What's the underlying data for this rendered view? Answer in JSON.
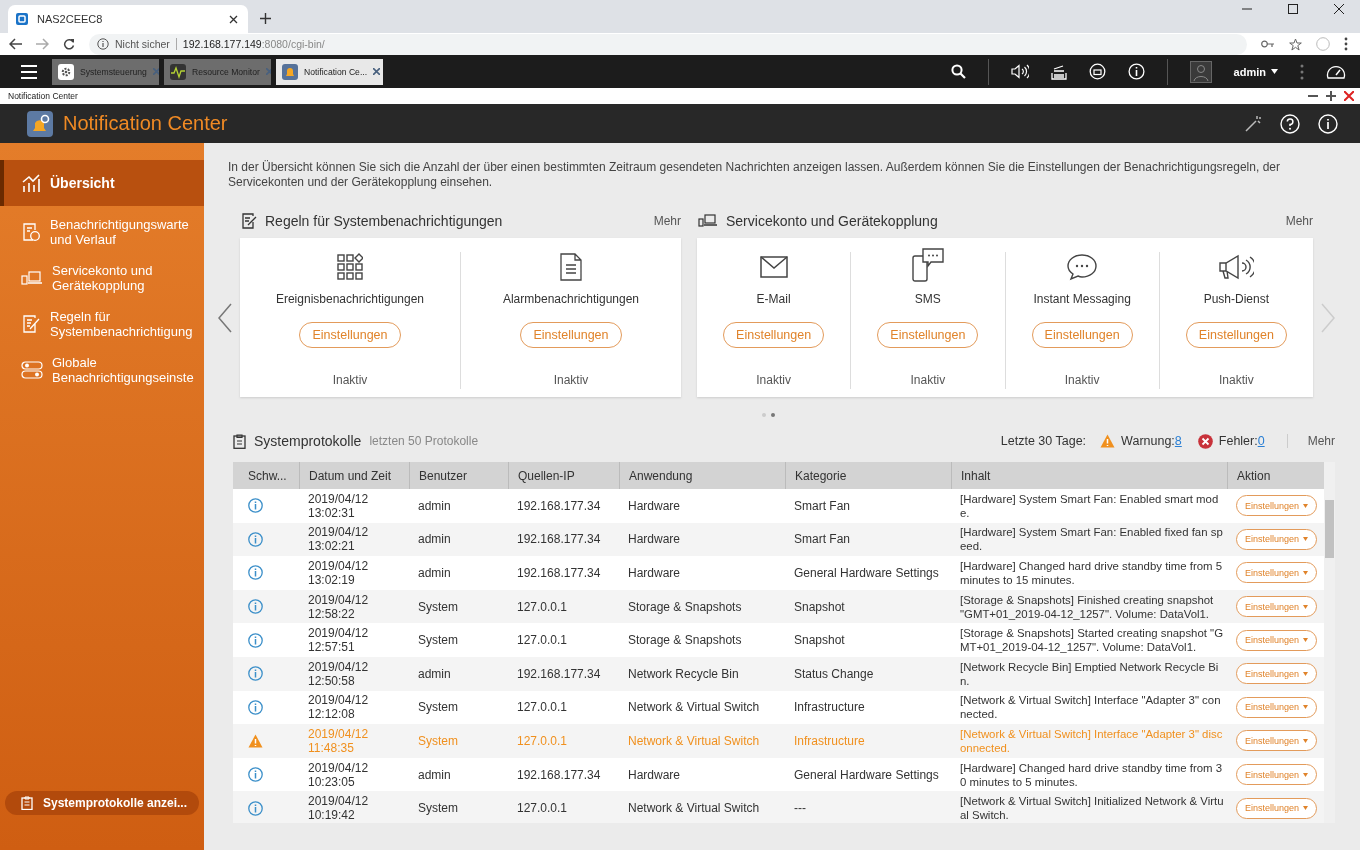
{
  "browser": {
    "tab_title": "NAS2CEEC8",
    "security": "Nicht sicher",
    "url_host": "192.168.177.149",
    "url_path": ":8080/cgi-bin/"
  },
  "taskbar": {
    "apps": [
      {
        "label": "Systemsteuerung",
        "selected": false
      },
      {
        "label": "Resource Monitor",
        "selected": false
      },
      {
        "label": "Notification Ce...",
        "selected": true
      }
    ],
    "user": "admin"
  },
  "window": {
    "title": "Notification Center",
    "app_title": "Notification Center"
  },
  "sidebar": {
    "items": [
      {
        "label": "Übersicht",
        "selected": true
      },
      {
        "label": "Benachrichtigungswarte und Verlauf",
        "selected": false
      },
      {
        "label": "Servicekonto und Gerätekopplung",
        "selected": false
      },
      {
        "label": "Regeln für Systembenachrichtigung",
        "selected": false
      },
      {
        "label": "Globale Benachrichtigungseinste",
        "selected": false
      }
    ],
    "bottom_button": "Systemprotokolle anzei..."
  },
  "intro": "In der Übersicht können Sie sich die Anzahl der über einen bestimmten Zeitraum gesendeten Nachrichten anzeigen lassen. Außerdem können Sie die Einstellungen der Benachrichtigungsregeln, der Servicekonten und der Gerätekopplung einsehen.",
  "panels": [
    {
      "title": "Regeln für Systembenachrichtigungen",
      "more": "Mehr",
      "items": [
        {
          "label": "Ereignisbenachrichtigungen",
          "button": "Einstellungen",
          "status": "Inaktiv"
        },
        {
          "label": "Alarmbenachrichtigungen",
          "button": "Einstellungen",
          "status": "Inaktiv"
        }
      ]
    },
    {
      "title": "Servicekonto und Gerätekopplung",
      "more": "Mehr",
      "items": [
        {
          "label": "E-Mail",
          "button": "Einstellungen",
          "status": "Inaktiv"
        },
        {
          "label": "SMS",
          "button": "Einstellungen",
          "status": "Inaktiv"
        },
        {
          "label": "Instant Messaging",
          "button": "Einstellungen",
          "status": "Inaktiv"
        },
        {
          "label": "Push-Dienst",
          "button": "Einstellungen",
          "status": "Inaktiv"
        }
      ]
    }
  ],
  "pager": [
    {
      "selected": false
    },
    {
      "selected": true
    }
  ],
  "logs": {
    "title": "Systemprotokolle",
    "subtitle": "letzten 50 Protokolle",
    "range_label": "Letzte 30 Tage:",
    "warning_label": "Warnung:",
    "warning_count": "8",
    "error_label": "Fehler:",
    "error_count": "0",
    "more": "Mehr",
    "columns": [
      "Schw...",
      "Datum und Zeit",
      "Benutzer",
      "Quellen-IP",
      "Anwendung",
      "Kategorie",
      "Inhalt",
      "Aktion"
    ],
    "rows": [
      {
        "kind": "info",
        "date": "2019/04/12",
        "time": "13:02:31",
        "user": "admin",
        "ip": "192.168.177.34",
        "app": "Hardware",
        "category": "Smart Fan",
        "content": "[Hardware] System Smart Fan: Enabled smart mode.",
        "action": "Einstellungen"
      },
      {
        "kind": "info",
        "date": "2019/04/12",
        "time": "13:02:21",
        "user": "admin",
        "ip": "192.168.177.34",
        "app": "Hardware",
        "category": "Smart Fan",
        "content": "[Hardware] System Smart Fan: Enabled fixed fan speed.",
        "action": "Einstellungen"
      },
      {
        "kind": "info",
        "date": "2019/04/12",
        "time": "13:02:19",
        "user": "admin",
        "ip": "192.168.177.34",
        "app": "Hardware",
        "category": "General Hardware Settings",
        "content": "[Hardware] Changed hard drive standby time from 5 minutes to 15 minutes.",
        "action": "Einstellungen"
      },
      {
        "kind": "info",
        "date": "2019/04/12",
        "time": "12:58:22",
        "user": "System",
        "ip": "127.0.0.1",
        "app": "Storage & Snapshots",
        "category": "Snapshot",
        "content": "[Storage & Snapshots] Finished creating snapshot \"GMT+01_2019-04-12_1257\". Volume: DataVol1.",
        "action": "Einstellungen"
      },
      {
        "kind": "info",
        "date": "2019/04/12",
        "time": "12:57:51",
        "user": "System",
        "ip": "127.0.0.1",
        "app": "Storage & Snapshots",
        "category": "Snapshot",
        "content": "[Storage & Snapshots] Started creating snapshot \"GMT+01_2019-04-12_1257\". Volume: DataVol1.",
        "action": "Einstellungen"
      },
      {
        "kind": "info",
        "date": "2019/04/12",
        "time": "12:50:58",
        "user": "admin",
        "ip": "192.168.177.34",
        "app": "Network Recycle Bin",
        "category": "Status Change",
        "content": "[Network Recycle Bin] Emptied Network Recycle Bin.",
        "action": "Einstellungen"
      },
      {
        "kind": "info",
        "date": "2019/04/12",
        "time": "12:12:08",
        "user": "System",
        "ip": "127.0.0.1",
        "app": "Network & Virtual Switch",
        "category": "Infrastructure",
        "content": "[Network & Virtual Switch] Interface \"Adapter 3\" connected.",
        "action": "Einstellungen"
      },
      {
        "kind": "warning",
        "date": "2019/04/12",
        "time": "11:48:35",
        "user": "System",
        "ip": "127.0.0.1",
        "app": "Network & Virtual Switch",
        "category": "Infrastructure",
        "content": "[Network & Virtual Switch] Interface \"Adapter 3\" disconnected.",
        "action": "Einstellungen"
      },
      {
        "kind": "info",
        "date": "2019/04/12",
        "time": "10:23:05",
        "user": "admin",
        "ip": "192.168.177.34",
        "app": "Hardware",
        "category": "General Hardware Settings",
        "content": "[Hardware] Changed hard drive standby time from 30 minutes to 5 minutes.",
        "action": "Einstellungen"
      },
      {
        "kind": "info",
        "date": "2019/04/12",
        "time": "10:19:42",
        "user": "System",
        "ip": "127.0.0.1",
        "app": "Network & Virtual Switch",
        "category": "---",
        "content": "[Network & Virtual Switch] Initialized Network & Virtual Switch.",
        "action": "Einstellungen"
      }
    ]
  }
}
